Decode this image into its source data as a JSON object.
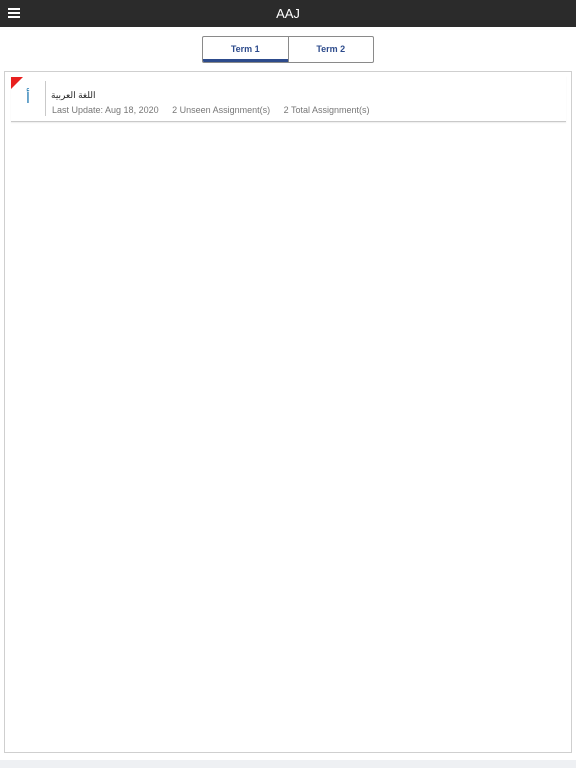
{
  "header": {
    "title": "AAJ",
    "menu_icon": "hamburger-icon"
  },
  "tabs": [
    {
      "label": "Term 1",
      "active": true
    },
    {
      "label": "Term 2",
      "active": false
    }
  ],
  "subjects": [
    {
      "letter": "أ",
      "name": "اللغة العربية",
      "last_update": "Last Update: Aug 18, 2020",
      "unseen": "2 Unseen Assignment(s)",
      "total": "2 Total Assignment(s)",
      "flag_color": "#e8201f"
    }
  ],
  "colors": {
    "topbar": "#2b2b2b",
    "accent": "#2d4b8c",
    "letter": "#2a7fb5",
    "flag": "#e8201f"
  }
}
